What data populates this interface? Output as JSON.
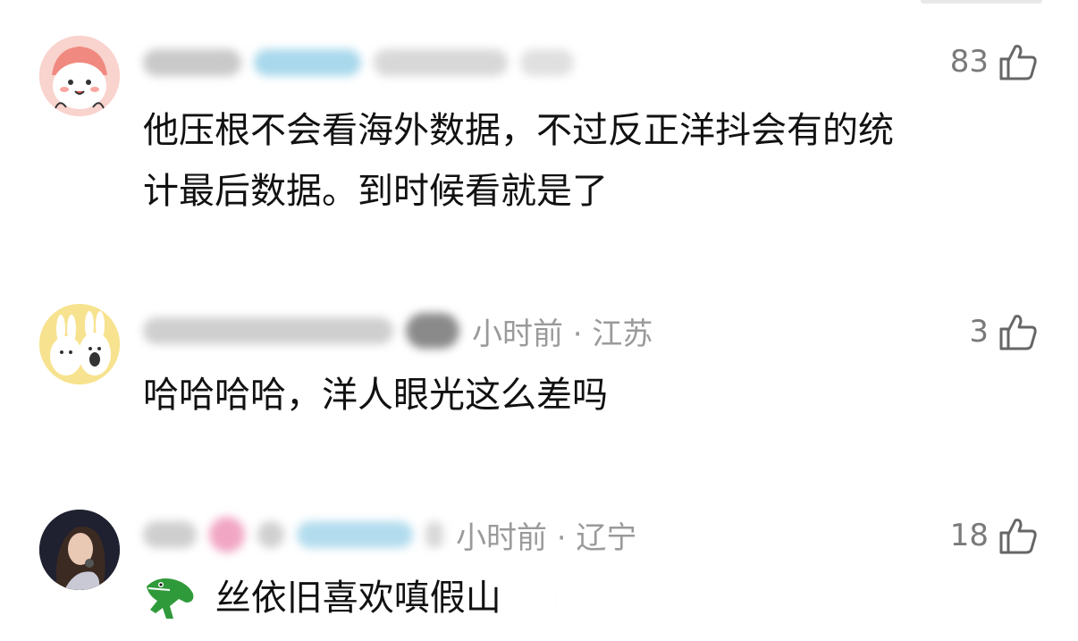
{
  "comments": [
    {
      "meta_text": "",
      "likes": "83",
      "text_line1": "他压根不会看海外数据，不过反正洋抖会有的统",
      "text_line2": "计最后数据。到时候看就是了"
    },
    {
      "meta_text": "小时前 · 江苏",
      "likes": "3",
      "text_line1": "哈哈哈哈，洋人眼光这么差吗"
    },
    {
      "meta_text": "小时前 · 辽宁",
      "likes": "18",
      "text_line1": "丝依旧喜欢嗔假山"
    }
  ],
  "colors": {
    "meta": "#9a9a9a",
    "text": "#111111",
    "like": "#7a7a7a"
  },
  "icons": {
    "like": "thumb-up-outline-icon",
    "emoji": "crocodile-emoji"
  }
}
